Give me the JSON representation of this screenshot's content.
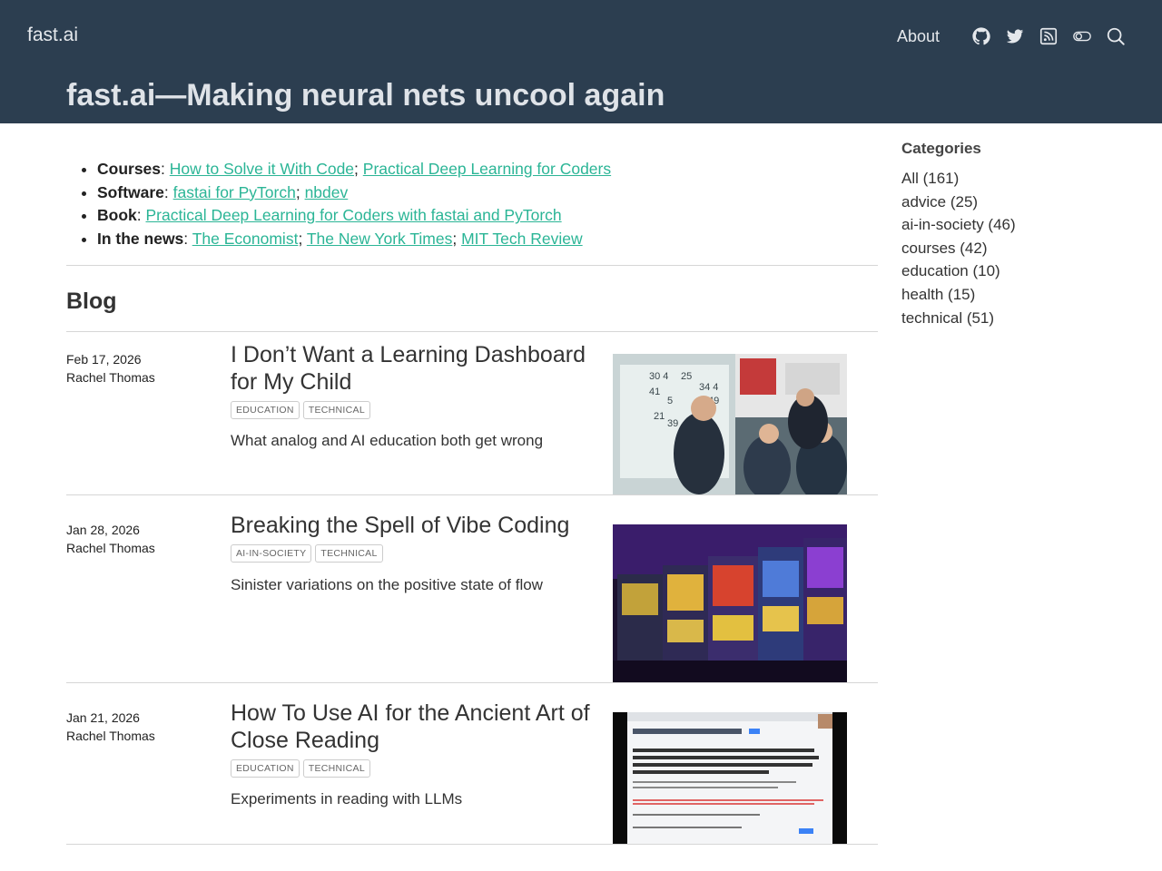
{
  "header": {
    "brand": "fast.ai",
    "nav": {
      "about": "About"
    },
    "icons": [
      "github-icon",
      "twitter-icon",
      "rss-icon",
      "theme-toggle-icon",
      "search-icon"
    ],
    "title": "fast.ai—Making neural nets uncool again",
    "background": "#2c3e50"
  },
  "intro": {
    "courses_label": "Courses",
    "courses": [
      "How to Solve it With Code",
      "Practical Deep Learning for Coders"
    ],
    "software_label": "Software",
    "software": [
      "fastai for PyTorch",
      "nbdev"
    ],
    "book_label": "Book",
    "book": [
      "Practical Deep Learning for Coders with fastai and PyTorch"
    ],
    "news_label": "In the news",
    "news": [
      "The Economist",
      "The New York Times",
      "MIT Tech Review"
    ],
    "link_color": "#2bb596"
  },
  "blog": {
    "heading": "Blog",
    "posts": [
      {
        "date": "Feb 17, 2026",
        "author": "Rachel Thomas",
        "title": "I Don’t Want a Learning Dashboard for My Child",
        "tags": [
          "EDUCATION",
          "TECHNICAL"
        ],
        "description": "What analog and AI education both get wrong"
      },
      {
        "date": "Jan 28, 2026",
        "author": "Rachel Thomas",
        "title": "Breaking the Spell of Vibe Coding",
        "tags": [
          "AI-IN-SOCIETY",
          "TECHNICAL"
        ],
        "description": "Sinister variations on the positive state of flow"
      },
      {
        "date": "Jan 21, 2026",
        "author": "Rachel Thomas",
        "title": "How To Use AI for the Ancient Art of Close Reading",
        "tags": [
          "EDUCATION",
          "TECHNICAL"
        ],
        "description": "Experiments in reading with LLMs"
      }
    ]
  },
  "sidebar": {
    "title": "Categories",
    "categories": [
      "All (161)",
      "advice (25)",
      "ai-in-society (46)",
      "courses (42)",
      "education (10)",
      "health (15)",
      "technical (51)"
    ]
  }
}
